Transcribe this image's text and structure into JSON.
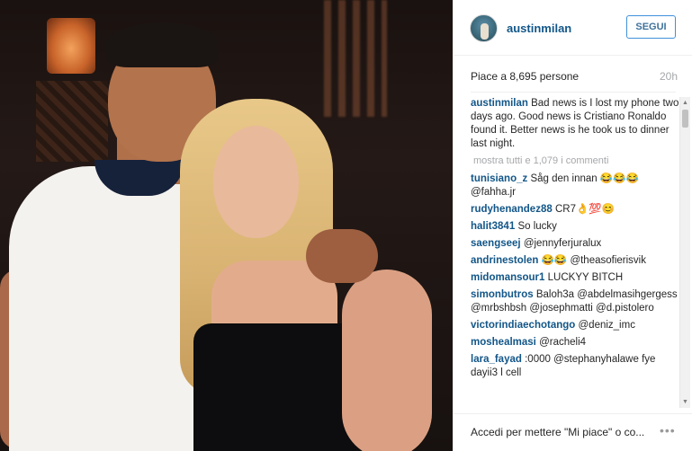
{
  "post": {
    "username": "austinmilan",
    "follow_label": "SEGUI",
    "likes": "Piace a 8,695 persone",
    "time": "20h",
    "caption_user": "austinmilan",
    "caption_text": "Bad news is I lost my phone two days ago. Good news is Cristiano Ronaldo found it. Better news is he took us to dinner last night.",
    "view_all": "mostra tutti e 1,079 i commenti"
  },
  "comments": [
    {
      "user": "tunisiano_z",
      "text": "Såg den innan 😂😂😂 @fahha.jr"
    },
    {
      "user": "rudyhenandez88",
      "text": "CR7👌💯😊"
    },
    {
      "user": "halit3841",
      "text": "So lucky"
    },
    {
      "user": "saengseej",
      "text": "@jennyferjuralux"
    },
    {
      "user": "andrinestolen",
      "text": "😂😂 @theasofierisvik"
    },
    {
      "user": "midomansour1",
      "text": "LUCKYY BITCH"
    },
    {
      "user": "simonbutros",
      "text": "Baloh3a @abdelmasihgergess @mrbshbsh @josephmatti @d.pistolero"
    },
    {
      "user": "victorindiaechotango",
      "text": "@deniz_imc"
    },
    {
      "user": "moshealmasi",
      "text": "@racheli4"
    },
    {
      "user": "lara_fayad",
      "text": ":0000 @stephanyhalawe fye dayii3 l cell"
    }
  ],
  "footer": {
    "login_text": "Accedi per mettere \"Mi piace\" o co...",
    "more_label": "•••"
  },
  "icons": {
    "more": "more-options-icon",
    "scroll_up": "scroll-up-arrow-icon",
    "scroll_down": "scroll-down-arrow-icon"
  },
  "colors": {
    "link": "#125688",
    "follow_border": "#4090db",
    "muted": "#a5a7aa"
  }
}
